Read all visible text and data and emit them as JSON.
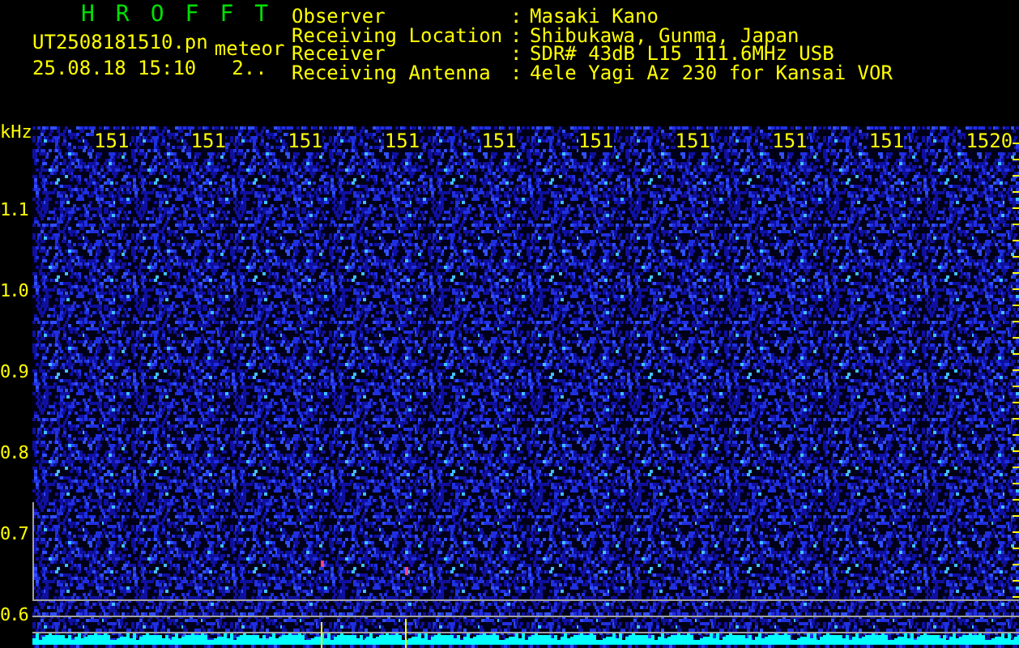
{
  "header": {
    "program": "HROFFT",
    "file_name": "UT2508181510.pn",
    "mode": "meteor",
    "timestamp": "25.08.18 15:10",
    "count": "2..",
    "info": [
      {
        "label": "Observer",
        "separator": ":",
        "value": "Masaki Kano"
      },
      {
        "label": "Receiving Location",
        "separator": ":",
        "value": "Shibukawa, Gunma, Japan"
      },
      {
        "label": "Receiver",
        "separator": ":",
        "value": "SDR# 43dB L15 111.6MHz USB"
      },
      {
        "label": "Receiving Antenna",
        "separator": ":",
        "value": "4ele Yagi Az 230 for Kansai VOR"
      }
    ]
  },
  "plot": {
    "y_unit": "kHz",
    "y_labels": [
      "1.1",
      "1.0",
      "0.9",
      "0.8",
      "0.7",
      "0.6"
    ],
    "x_labels": [
      "151",
      "151",
      "151",
      "151",
      "151",
      "151",
      "151",
      "151",
      "151",
      "1520"
    ]
  }
}
